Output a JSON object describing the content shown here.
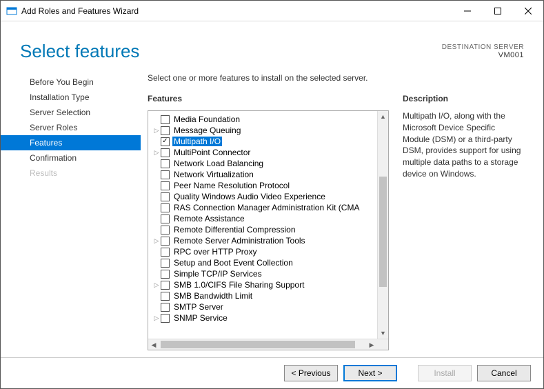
{
  "window": {
    "title": "Add Roles and Features Wizard"
  },
  "page": {
    "title": "Select features"
  },
  "destination": {
    "label": "DESTINATION SERVER",
    "name": "VM001"
  },
  "nav": {
    "items": [
      {
        "label": "Before You Begin",
        "state": "normal"
      },
      {
        "label": "Installation Type",
        "state": "normal"
      },
      {
        "label": "Server Selection",
        "state": "normal"
      },
      {
        "label": "Server Roles",
        "state": "normal"
      },
      {
        "label": "Features",
        "state": "active"
      },
      {
        "label": "Confirmation",
        "state": "normal"
      },
      {
        "label": "Results",
        "state": "disabled"
      }
    ]
  },
  "instruction": "Select one or more features to install on the selected server.",
  "features_section_label": "Features",
  "description_section_label": "Description",
  "features": [
    {
      "label": "Media Foundation",
      "checked": false,
      "expandable": false,
      "selected": false
    },
    {
      "label": "Message Queuing",
      "checked": false,
      "expandable": true,
      "selected": false
    },
    {
      "label": "Multipath I/O",
      "checked": true,
      "expandable": false,
      "selected": true
    },
    {
      "label": "MultiPoint Connector",
      "checked": false,
      "expandable": true,
      "selected": false
    },
    {
      "label": "Network Load Balancing",
      "checked": false,
      "expandable": false,
      "selected": false
    },
    {
      "label": "Network Virtualization",
      "checked": false,
      "expandable": false,
      "selected": false
    },
    {
      "label": "Peer Name Resolution Protocol",
      "checked": false,
      "expandable": false,
      "selected": false
    },
    {
      "label": "Quality Windows Audio Video Experience",
      "checked": false,
      "expandable": false,
      "selected": false
    },
    {
      "label": "RAS Connection Manager Administration Kit (CMA",
      "checked": false,
      "expandable": false,
      "selected": false
    },
    {
      "label": "Remote Assistance",
      "checked": false,
      "expandable": false,
      "selected": false
    },
    {
      "label": "Remote Differential Compression",
      "checked": false,
      "expandable": false,
      "selected": false
    },
    {
      "label": "Remote Server Administration Tools",
      "checked": false,
      "expandable": true,
      "selected": false
    },
    {
      "label": "RPC over HTTP Proxy",
      "checked": false,
      "expandable": false,
      "selected": false
    },
    {
      "label": "Setup and Boot Event Collection",
      "checked": false,
      "expandable": false,
      "selected": false
    },
    {
      "label": "Simple TCP/IP Services",
      "checked": false,
      "expandable": false,
      "selected": false
    },
    {
      "label": "SMB 1.0/CIFS File Sharing Support",
      "checked": false,
      "expandable": true,
      "selected": false
    },
    {
      "label": "SMB Bandwidth Limit",
      "checked": false,
      "expandable": false,
      "selected": false
    },
    {
      "label": "SMTP Server",
      "checked": false,
      "expandable": false,
      "selected": false
    },
    {
      "label": "SNMP Service",
      "checked": false,
      "expandable": true,
      "selected": false
    }
  ],
  "description_text": "Multipath I/O, along with the Microsoft Device Specific Module (DSM) or a third-party DSM, provides support for using multiple data paths to a storage device on Windows.",
  "buttons": {
    "previous": "< Previous",
    "next": "Next >",
    "install": "Install",
    "cancel": "Cancel"
  }
}
